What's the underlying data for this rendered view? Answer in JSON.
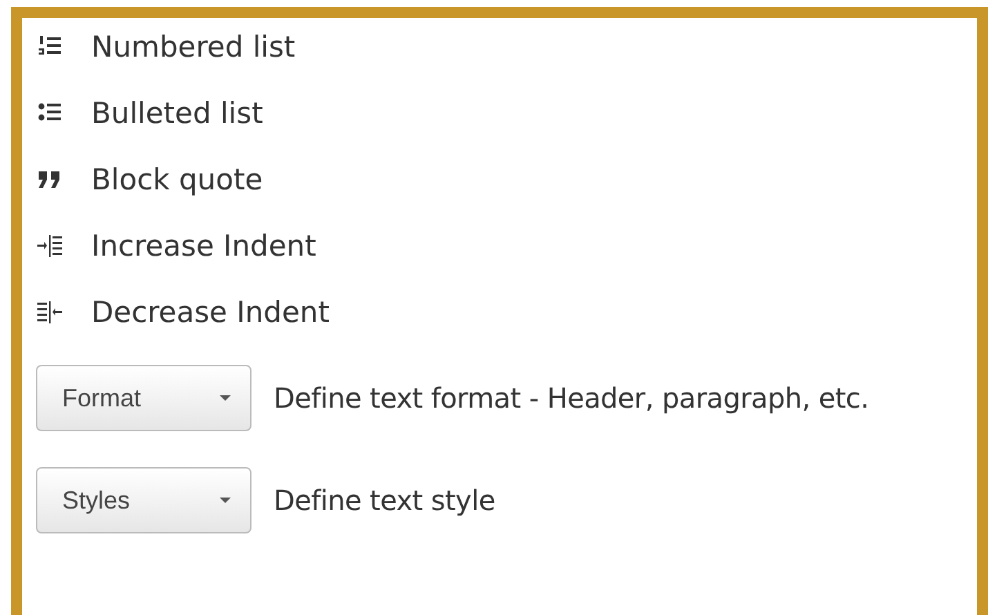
{
  "toolbar_items": [
    {
      "kind": "numbered",
      "label": "Numbered list"
    },
    {
      "kind": "bulleted",
      "label": "Bulleted list"
    },
    {
      "kind": "quote",
      "label": "Block quote"
    },
    {
      "kind": "indent",
      "label": "Increase Indent"
    },
    {
      "kind": "outdent",
      "label": "Decrease Indent"
    }
  ],
  "dropdowns": [
    {
      "label": "Format",
      "description": "Define text format - Header, paragraph, etc."
    },
    {
      "label": "Styles",
      "description": "Define text style"
    }
  ]
}
